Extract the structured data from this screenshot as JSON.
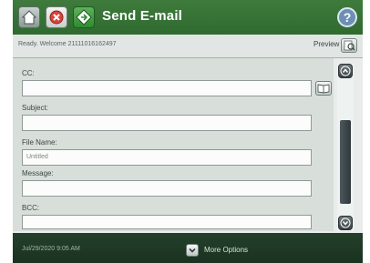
{
  "header": {
    "title": "Send E-mail",
    "help_label": "?"
  },
  "status": {
    "text": "Ready. Welcome 21111016162497",
    "preview_label": "Preview"
  },
  "form": {
    "fields": [
      {
        "label": "CC:",
        "value": ""
      },
      {
        "label": "Subject:",
        "value": ""
      },
      {
        "label": "File Name:",
        "value": "Untitled"
      },
      {
        "label": "Message:",
        "value": ""
      },
      {
        "label": "BCC:",
        "value": ""
      }
    ]
  },
  "footer": {
    "timestamp": "Jul/29/2020 9:05 AM",
    "more_options_label": "More Options"
  },
  "icons": {
    "home": "home-icon",
    "stop": "stop-icon",
    "send": "send-icon",
    "help": "help-icon",
    "preview": "preview-icon",
    "address_book": "address-book-icon",
    "scroll_up": "chevron-up-icon",
    "scroll_down": "chevron-down-icon",
    "more_options": "chevron-down-icon"
  },
  "colors": {
    "header_green": "#2f6a30",
    "stop_red": "#d9433b",
    "help_blue": "#6d8fb5"
  }
}
